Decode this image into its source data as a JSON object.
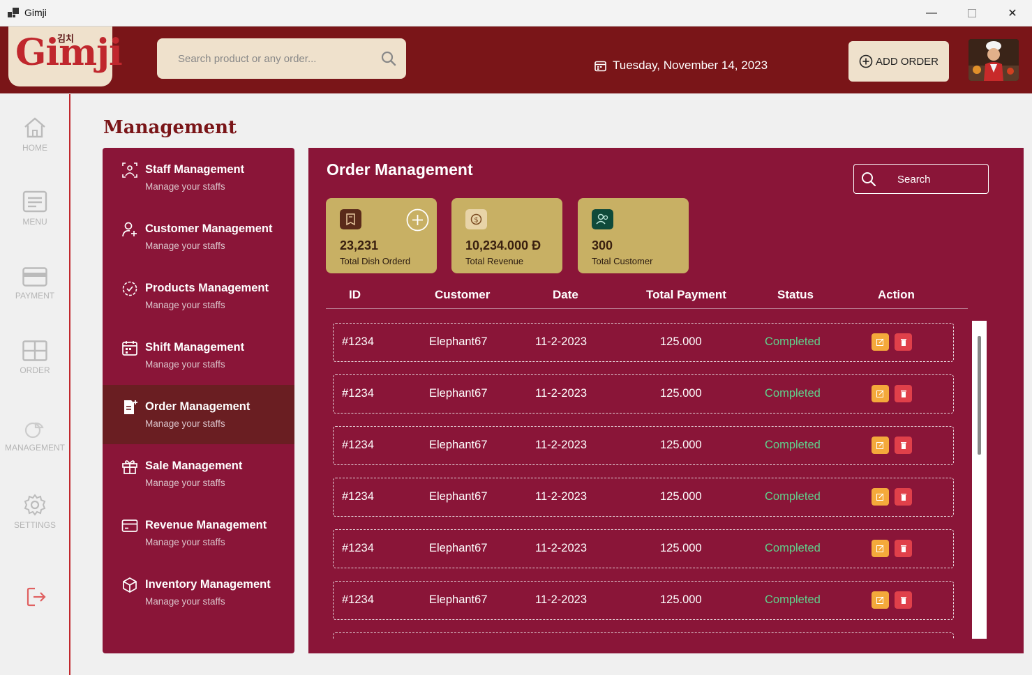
{
  "window": {
    "title": "Gimji",
    "minimize_glyph": "—",
    "close_glyph": "✕"
  },
  "header": {
    "logo_text": "Gimji",
    "logo_korean": "김치",
    "search_placeholder": "Search product or any order...",
    "date": "Tuesday, November 14, 2023",
    "add_order_label": "ADD ORDER"
  },
  "nav": {
    "items": [
      {
        "label": "HOME",
        "icon": "home-icon"
      },
      {
        "label": "MENU",
        "icon": "menu-icon"
      },
      {
        "label": "PAYMENT",
        "icon": "payment-icon"
      },
      {
        "label": "ORDER",
        "icon": "order-icon"
      },
      {
        "label": "MANAGEMENT",
        "icon": "management-icon"
      },
      {
        "label": "SETTINGS",
        "icon": "settings-icon"
      }
    ],
    "logout_icon": "logout-icon"
  },
  "page_title": "Management",
  "mgmt_menu": [
    {
      "title": "Staff Management",
      "sub": "Manage your staffs",
      "icon": "staff-icon"
    },
    {
      "title": "Customer Management",
      "sub": "Manage your staffs",
      "icon": "customer-icon"
    },
    {
      "title": "Products Management",
      "sub": "Manage your staffs",
      "icon": "products-icon"
    },
    {
      "title": "Shift Management",
      "sub": "Manage your staffs",
      "icon": "calendar-icon"
    },
    {
      "title": "Order Management",
      "sub": "Manage your staffs",
      "icon": "order-doc-icon",
      "active": true
    },
    {
      "title": "Sale Management",
      "sub": "Manage your staffs",
      "icon": "gift-icon"
    },
    {
      "title": "Revenue Management",
      "sub": "Manage your staffs",
      "icon": "card-icon"
    },
    {
      "title": "Inventory Management",
      "sub": "Manage your staffs",
      "icon": "box-icon"
    }
  ],
  "order_panel": {
    "title": "Order Management",
    "search_label": "Search",
    "stats": [
      {
        "value": "23,231",
        "label": "Total Dish Orderd"
      },
      {
        "value": "10,234.000 Đ",
        "label": "Total Revenue"
      },
      {
        "value": "300",
        "label": "Total Customer"
      }
    ],
    "columns": [
      "ID",
      "Customer",
      "Date",
      "Total Payment",
      "Status",
      "Action"
    ],
    "rows": [
      {
        "id": "#1234",
        "customer": "Elephant67",
        "date": "11-2-2023",
        "total": "125.000",
        "status": "Completed"
      },
      {
        "id": "#1234",
        "customer": "Elephant67",
        "date": "11-2-2023",
        "total": "125.000",
        "status": "Completed"
      },
      {
        "id": "#1234",
        "customer": "Elephant67",
        "date": "11-2-2023",
        "total": "125.000",
        "status": "Completed"
      },
      {
        "id": "#1234",
        "customer": "Elephant67",
        "date": "11-2-2023",
        "total": "125.000",
        "status": "Completed"
      },
      {
        "id": "#1234",
        "customer": "Elephant67",
        "date": "11-2-2023",
        "total": "125.000",
        "status": "Completed"
      },
      {
        "id": "#1234",
        "customer": "Elephant67",
        "date": "11-2-2023",
        "total": "125.000",
        "status": "Completed"
      }
    ]
  },
  "colors": {
    "header_bg": "#7a1518",
    "panel_bg": "#8a1538",
    "active_item_bg": "#6a1e22",
    "card_bg": "#c8b064",
    "status_completed": "#5fd38c",
    "edit_btn": "#f4a93b",
    "delete_btn": "#e0404a"
  }
}
